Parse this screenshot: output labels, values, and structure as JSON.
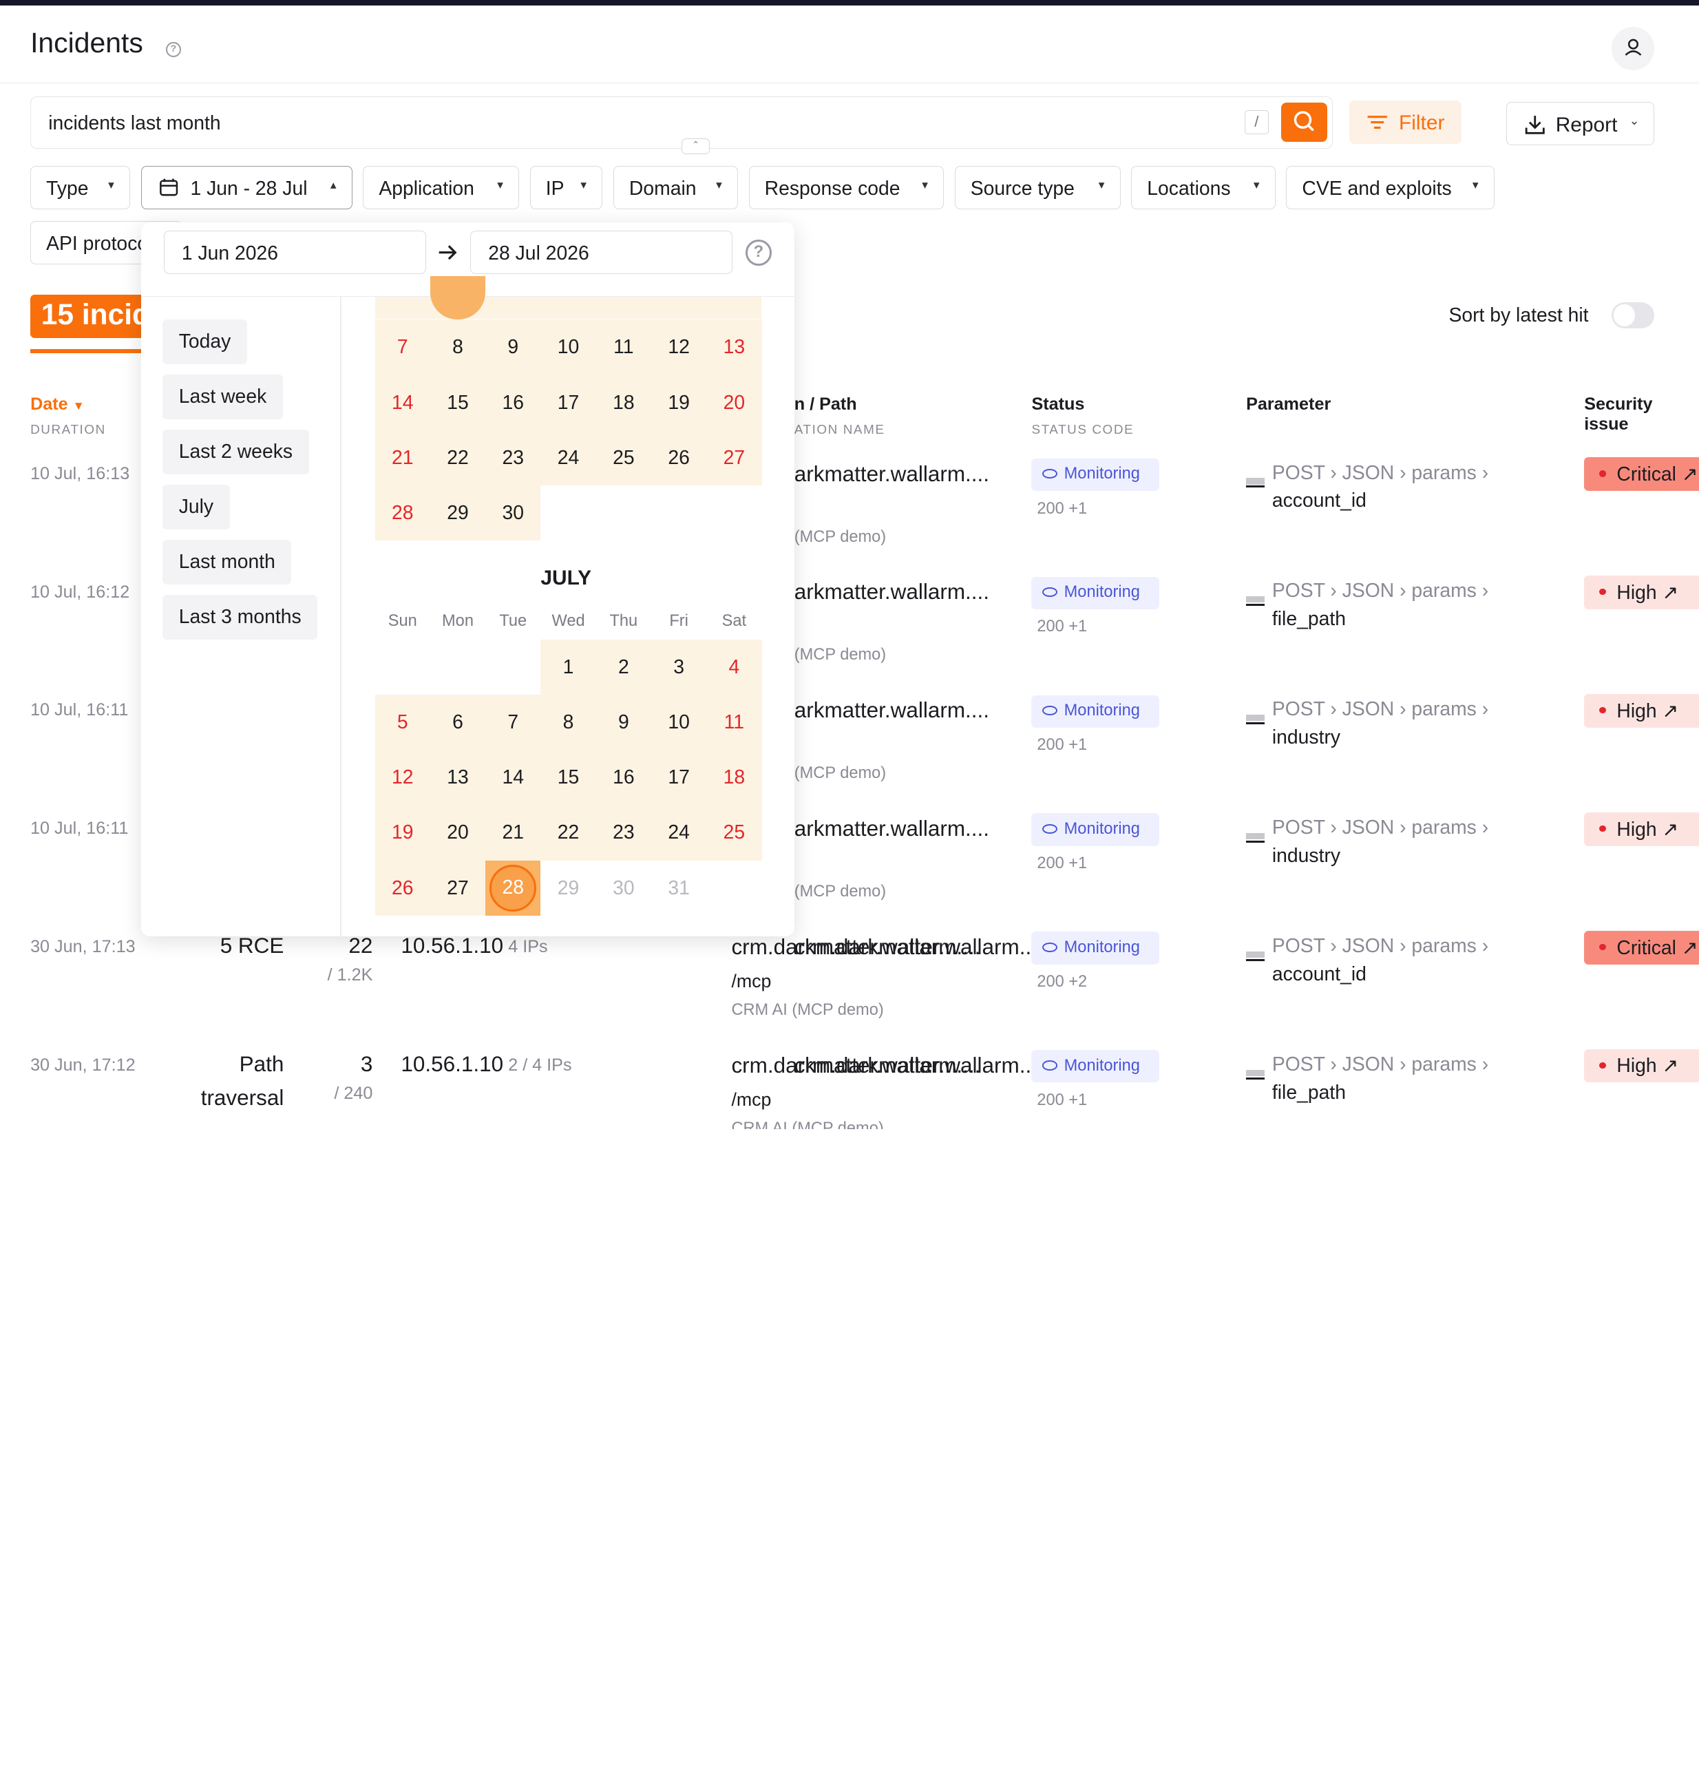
{
  "header": {
    "title": "Incidents"
  },
  "search": {
    "query": "incidents last month",
    "slash_hint": "/"
  },
  "toolbar": {
    "filter_label": "Filter",
    "report_label": "Report"
  },
  "filters": [
    {
      "label": "Type",
      "chevron": "chevron-down-icon"
    },
    {
      "label": "1 Jun - 28 Jul",
      "chevron": "chevron-up-icon"
    },
    {
      "label": "Application"
    },
    {
      "label": "IP"
    },
    {
      "label": "Domain"
    },
    {
      "label": "Response code"
    },
    {
      "label": "Source type"
    },
    {
      "label": "Locations"
    },
    {
      "label": "CVE and exploits"
    },
    {
      "label": "API protocol"
    }
  ],
  "datepicker": {
    "from": "1 Jun 2026",
    "to": "28 Jul 2026",
    "presets": [
      "Today",
      "Last week",
      "Last 2 weeks",
      "July",
      "Last month",
      "Last 3 months"
    ],
    "june_rows": [
      [
        "7",
        "8",
        "9",
        "10",
        "11",
        "12",
        "13"
      ],
      [
        "14",
        "15",
        "16",
        "17",
        "18",
        "19",
        "20"
      ],
      [
        "21",
        "22",
        "23",
        "24",
        "25",
        "26",
        "27"
      ],
      [
        "28",
        "29",
        "30"
      ]
    ],
    "july_title": "JULY",
    "weekdays": [
      "Sun",
      "Mon",
      "Tue",
      "Wed",
      "Thu",
      "Fri",
      "Sat"
    ],
    "july_rows": [
      [
        "",
        "",
        "",
        "1",
        "2",
        "3",
        "4"
      ],
      [
        "5",
        "6",
        "7",
        "8",
        "9",
        "10",
        "11"
      ],
      [
        "12",
        "13",
        "14",
        "15",
        "16",
        "17",
        "18"
      ],
      [
        "19",
        "20",
        "21",
        "22",
        "23",
        "24",
        "25"
      ],
      [
        "26",
        "27",
        "28",
        "29",
        "30",
        "31"
      ]
    ],
    "selected_end": "28"
  },
  "summary": {
    "count_label": "15 incidents",
    "sort_label": "Sort by latest hit",
    "sort_enabled": false
  },
  "columns": {
    "date": "Date",
    "date_sub": "DURATION",
    "path": "n / Path",
    "path_sub": "ATION NAME",
    "status": "Status",
    "status_sub": "STATUS CODE",
    "parameter": "Parameter",
    "security": "Security issue"
  },
  "rows": [
    {
      "date": "10 Jul, 16:13",
      "type": "",
      "hits": "",
      "hits_total": "",
      "ip": "",
      "ip_count": "",
      "domain": "arkmatter.wallarm....",
      "path": "",
      "app": "(MCP demo)",
      "status": "Monitoring",
      "code": "200 +1",
      "param_path": "POST › JSON › params ›",
      "param": "account_id",
      "severity": "Critical"
    },
    {
      "date": "10 Jul, 16:12",
      "type": "",
      "hits": "",
      "hits_total": "",
      "ip": "",
      "ip_count": "",
      "domain": "arkmatter.wallarm....",
      "path": "",
      "app": "(MCP demo)",
      "status": "Monitoring",
      "code": "200 +1",
      "param_path": "POST › JSON › params ›",
      "param": "file_path",
      "severity": "High"
    },
    {
      "date": "10 Jul, 16:11",
      "type": "",
      "hits": "",
      "hits_total": "",
      "ip": "",
      "ip_count": "",
      "domain": "arkmatter.wallarm....",
      "path": "",
      "app": "(MCP demo)",
      "status": "Monitoring",
      "code": "200 +1",
      "param_path": "POST › JSON › params ›",
      "param": "industry",
      "severity": "High"
    },
    {
      "date": "10 Jul, 16:11",
      "type": "",
      "hits": "",
      "hits_total": "",
      "ip": "",
      "ip_count": "",
      "domain": "arkmatter.wallarm....",
      "path": "",
      "app": "(MCP demo)",
      "status": "Monitoring",
      "code": "200 +1",
      "param_path": "POST › JSON › params ›",
      "param": "industry",
      "severity": "High"
    },
    {
      "date": "30 Jun, 17:13",
      "type": "5 RCE",
      "hits": "22",
      "hits_total": "/ 1.2K",
      "ip": "10.56.1.10",
      "ip_count": "4 IPs",
      "domain": "crm.darkmatter.wallarm....",
      "path": "/mcp",
      "app": "CRM AI (MCP demo)",
      "status": "Monitoring",
      "code": "200 +2",
      "param_path": "POST › JSON › params ›",
      "param": "account_id",
      "severity": "Critical"
    },
    {
      "date": "30 Jun, 17:12",
      "type": "Path",
      "type2": "traversal",
      "hits": "3",
      "hits_total": "/ 240",
      "ip": "10.56.1.10",
      "ip_count": "2 / 4  IPs",
      "domain": "crm.darkmatter.wallarm....",
      "path": "/mcp",
      "app": "CRM AI (MCP demo)",
      "status": "Monitoring",
      "code": "200 +1",
      "param_path": "POST › JSON › params ›",
      "param": "file_path",
      "severity": "High"
    }
  ]
}
